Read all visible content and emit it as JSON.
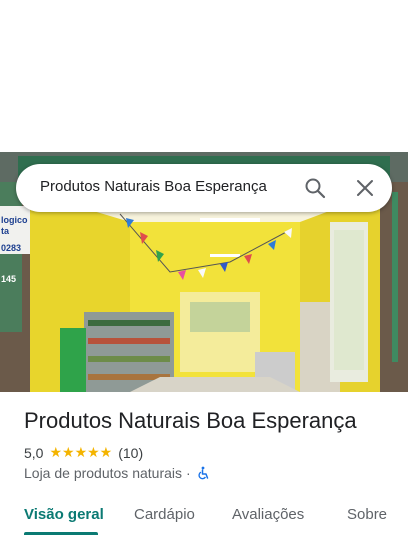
{
  "search": {
    "query": "Produtos Naturais Boa Esperança"
  },
  "icons": {
    "search": "search-icon",
    "close": "close-icon",
    "accessibility": "wheelchair-accessible-icon"
  },
  "photo": {
    "alt_icon": "storefront-photo",
    "sign_partial": "Produtos Naturais Boa Esperança",
    "left_sign_lines": [
      "logico",
      "ta",
      "0283",
      "145"
    ]
  },
  "place": {
    "name": "Produtos Naturais Boa Esperança",
    "rating": "5,0",
    "stars": "★★★★★",
    "review_count": "(10)",
    "category": "Loja de produtos naturais",
    "separator": "·"
  },
  "tabs": [
    {
      "label": "Visão geral",
      "active": true
    },
    {
      "label": "Cardápio",
      "active": false
    },
    {
      "label": "Avaliações",
      "active": false
    },
    {
      "label": "Sobre",
      "active": false
    }
  ],
  "colors": {
    "accent": "#0b7a73",
    "star": "#f4b400",
    "wall": "#f2e23a"
  }
}
